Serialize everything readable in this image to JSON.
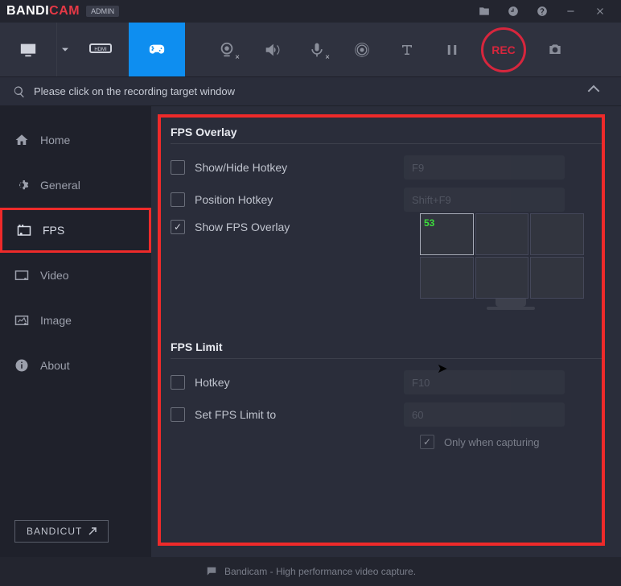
{
  "app": {
    "name_pre": "BANDI",
    "name_post": "CAM",
    "badge": "ADMIN"
  },
  "search": {
    "prompt": "Please click on the recording target window"
  },
  "sidebar": {
    "home": "Home",
    "general": "General",
    "fps": "FPS",
    "video": "Video",
    "image": "Image",
    "about": "About",
    "bandicut": "BANDICUT"
  },
  "fps_overlay": {
    "title": "FPS Overlay",
    "show_hide": "Show/Hide Hotkey",
    "show_hide_key": "F9",
    "position": "Position Hotkey",
    "position_key": "Shift+F9",
    "show_overlay": "Show FPS Overlay",
    "fps_value": "53"
  },
  "fps_limit": {
    "title": "FPS Limit",
    "hotkey": "Hotkey",
    "hotkey_key": "F10",
    "set_to": "Set FPS Limit to",
    "set_val": "60",
    "only_cap": "Only when capturing"
  },
  "rec": {
    "label": "REC"
  },
  "footer": {
    "text": "Bandicam - High performance video capture."
  }
}
